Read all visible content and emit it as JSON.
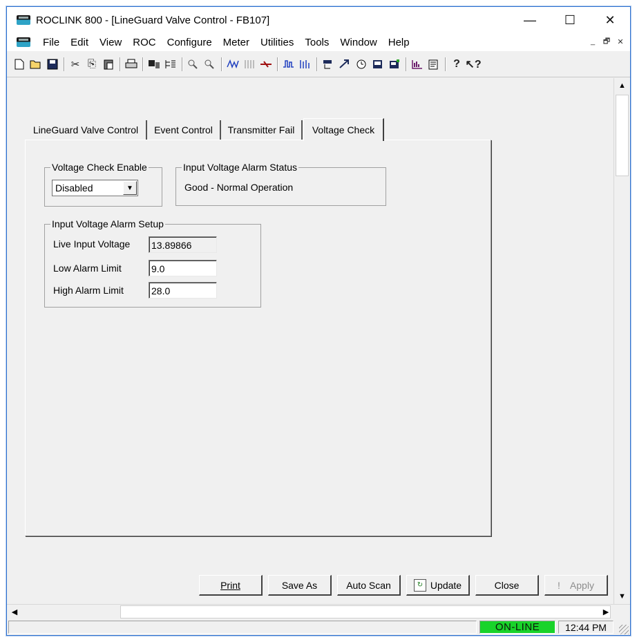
{
  "window": {
    "title": "ROCLINK 800 - [LineGuard Valve Control - FB107]",
    "controls": {
      "minimize": "—",
      "maximize": "☐",
      "close": "✕"
    }
  },
  "menu": {
    "items": [
      "File",
      "Edit",
      "View",
      "ROC",
      "Configure",
      "Meter",
      "Utilities",
      "Tools",
      "Window",
      "Help"
    ],
    "mdi": {
      "minimize": "_",
      "restore": "🗗",
      "close": "✕"
    }
  },
  "toolbar": {
    "icons": [
      "new-icon",
      "open-icon",
      "save-icon",
      "cut-icon",
      "copy-icon",
      "paste-icon",
      "print-icon",
      "connect-icon",
      "tree-icon",
      "zoom-in-icon",
      "zoom-out-icon",
      "trend-icon",
      "io-icon",
      "transfer-icon",
      "pulse-icon",
      "analog-icon",
      "pid-icon",
      "fst-icon",
      "clock-icon",
      "display-icon",
      "display-edit-icon",
      "chart-icon",
      "report-icon",
      "help-icon",
      "context-help-icon"
    ]
  },
  "tabs": [
    {
      "label": "LineGuard Valve Control",
      "active": false
    },
    {
      "label": "Event Control",
      "active": false
    },
    {
      "label": "Transmitter Fail",
      "active": false
    },
    {
      "label": "Voltage Check",
      "active": true
    }
  ],
  "voltage_check_enable": {
    "group_label": "Voltage Check Enable",
    "value": "Disabled"
  },
  "alarm_status": {
    "group_label": "Input Voltage Alarm Status",
    "value": "Good - Normal Operation"
  },
  "alarm_setup": {
    "group_label": "Input Voltage Alarm Setup",
    "live_input_label": "Live Input Voltage",
    "live_input_value": "13.89866",
    "low_limit_label": "Low Alarm Limit",
    "low_limit_value": "9.0",
    "high_limit_label": "High Alarm Limit",
    "high_limit_value": "28.0"
  },
  "buttons": {
    "print": "Print",
    "save_as": "Save As",
    "auto_scan": "Auto Scan",
    "update": "Update",
    "close": "Close",
    "apply": "Apply"
  },
  "status": {
    "connection": "ON-LINE",
    "time": "12:44 PM"
  },
  "colors": {
    "online": "#19d32a",
    "window_border": "#2b6fcf"
  }
}
